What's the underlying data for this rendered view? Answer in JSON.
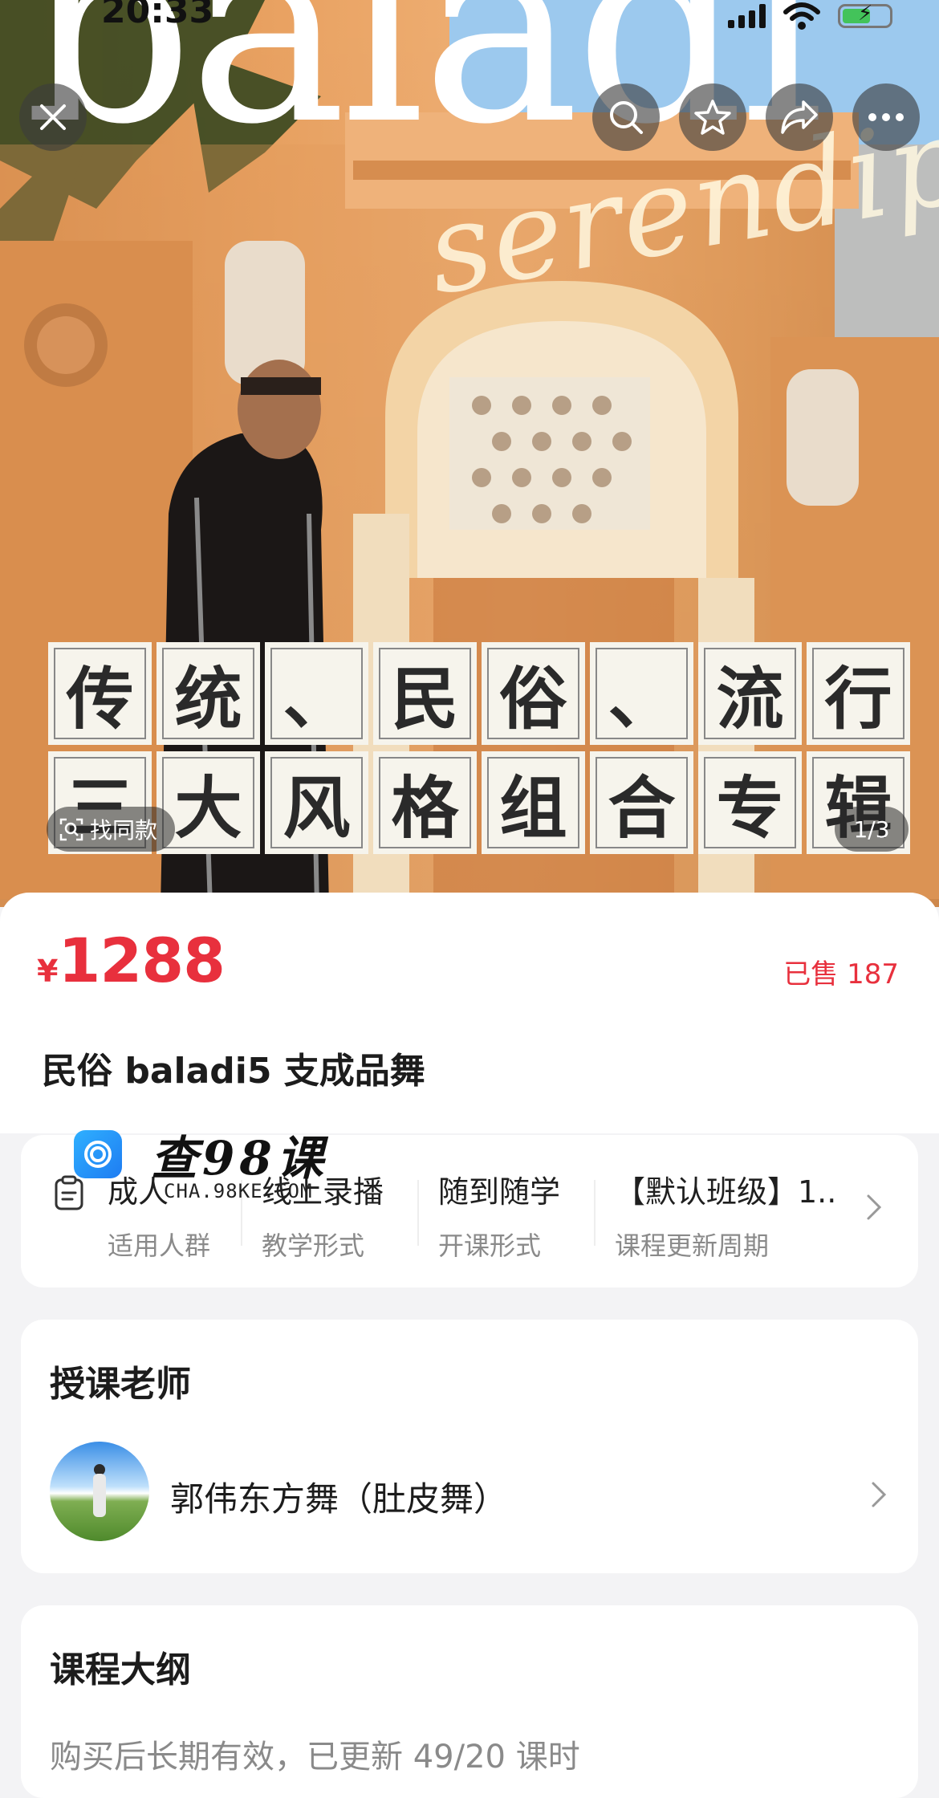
{
  "status_bar": {
    "time": "20:33"
  },
  "hero": {
    "big_word": "baladi",
    "script_word": "serendip",
    "title_rows": [
      [
        "传",
        "统",
        "、",
        "民",
        "俗",
        "、",
        "流",
        "行"
      ],
      [
        "三",
        "大",
        "风",
        "格",
        "组",
        "合",
        "专",
        "辑"
      ]
    ],
    "find_similar_label": "找同款",
    "page_indicator": "1/3",
    "close_icon": "close-icon",
    "search_icon": "search-icon",
    "favorite_icon": "star-icon",
    "share_icon": "share-icon",
    "more_icon": "more-icon"
  },
  "product": {
    "currency": "¥",
    "price": "1288",
    "sold": "已售 187",
    "title": "民俗 baladi5 支成品舞",
    "accent_color": "#e8303d"
  },
  "info": {
    "items": [
      {
        "value": "成人",
        "key": "适用人群"
      },
      {
        "value": "线上录播",
        "key": "教学形式"
      },
      {
        "value": "随到随学",
        "key": "开课形式"
      },
      {
        "value": "【默认班级】1..",
        "key": "课程更新周期"
      }
    ]
  },
  "watermark": {
    "text": "查98课",
    "url": "CHA.98KE.COM"
  },
  "teacher": {
    "section_title": "授课老师",
    "name": "郭伟东方舞（肚皮舞）"
  },
  "syllabus": {
    "section_title": "课程大纲",
    "subtitle": "购买后长期有效，已更新 49/20 课时"
  }
}
